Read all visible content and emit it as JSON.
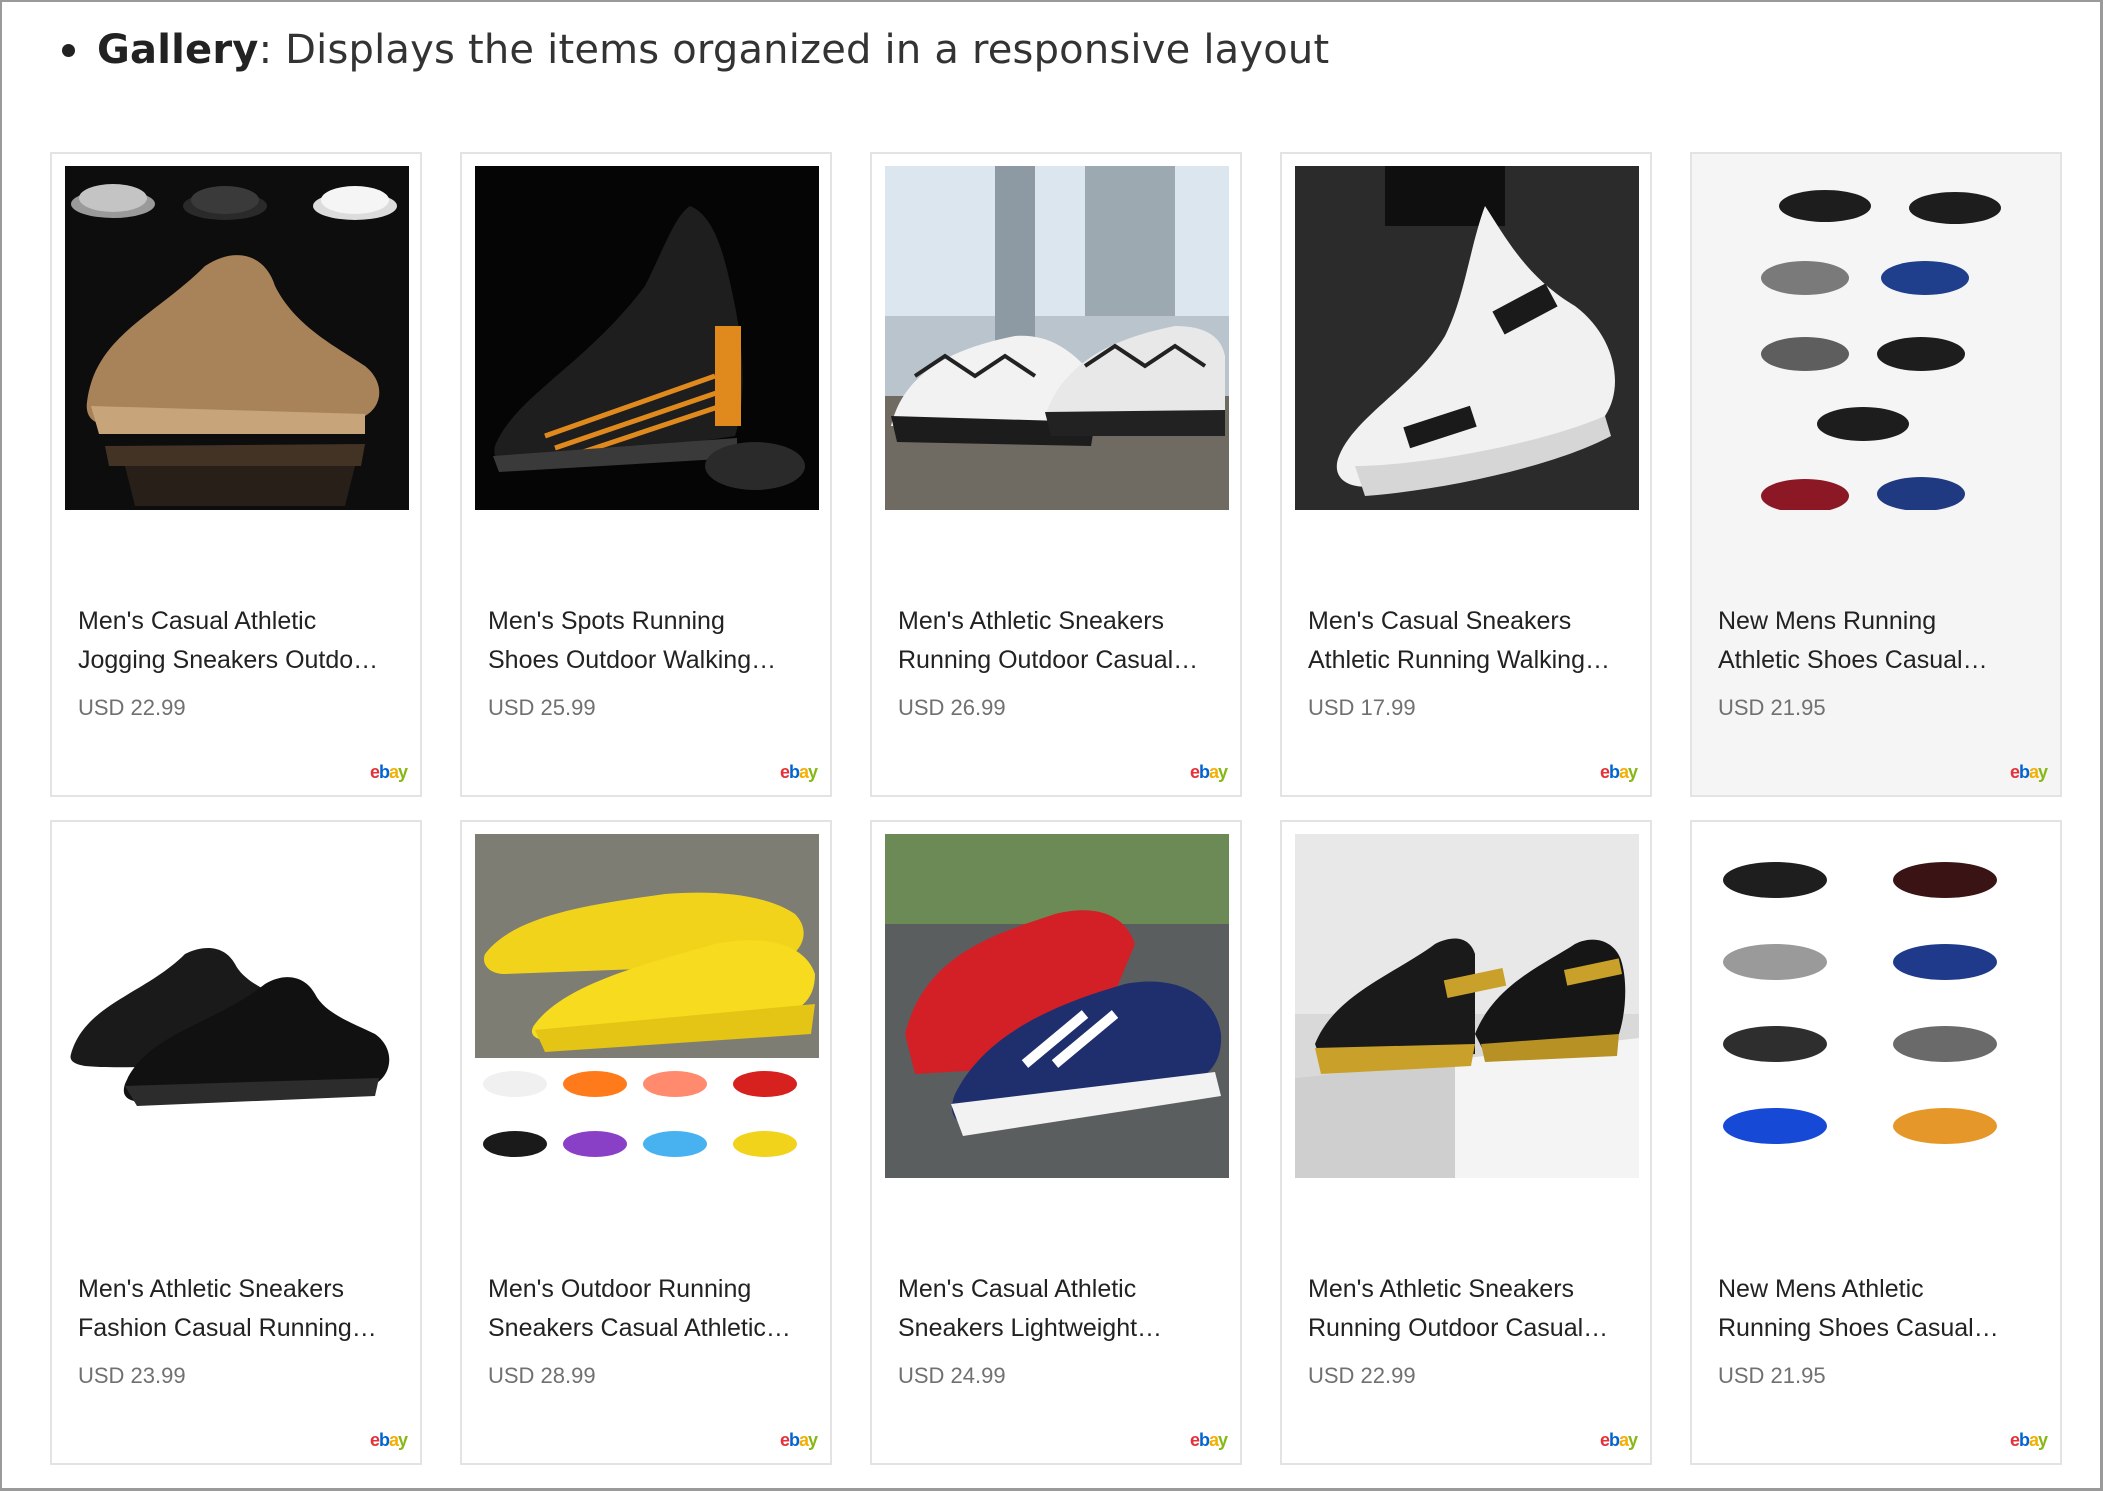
{
  "intro": {
    "label": "Gallery",
    "text": ": Displays the items organized in a responsive layout"
  },
  "gallery": {
    "items": [
      {
        "title_line1": "Men's Casual Athletic",
        "title_line2": "Jogging Sneakers Outdo…",
        "price": "USD 22.99",
        "source": "ebay",
        "image_icon": "tan-knit-sneaker-with-color-variants-photo"
      },
      {
        "title_line1": "Men's Spots Running",
        "title_line2": "Shoes Outdoor Walking…",
        "price": "USD 25.99",
        "source": "ebay",
        "image_icon": "black-orange-sneaker-photo"
      },
      {
        "title_line1": "Men's Athletic Sneakers",
        "title_line2": "Running Outdoor Casual…",
        "price": "USD 26.99",
        "source": "ebay",
        "image_icon": "white-black-pattern-sneakers-photo"
      },
      {
        "title_line1": "Men's Casual Sneakers",
        "title_line2": "Athletic Running Walking…",
        "price": "USD 17.99",
        "source": "ebay",
        "image_icon": "white-slip-on-sneaker-on-foot-photo"
      },
      {
        "title_line1": "New Mens Running",
        "title_line2": "Athletic Shoes Casual…",
        "price": "USD 21.95",
        "source": "ebay",
        "image_icon": "sneaker-color-variants-grid-photo"
      },
      {
        "title_line1": "Men's Athletic Sneakers",
        "title_line2": "Fashion Casual Running…",
        "price": "USD 23.99",
        "source": "ebay",
        "image_icon": "black-knit-sneakers-photo"
      },
      {
        "title_line1": "Men's Outdoor Running",
        "title_line2": "Sneakers Casual Athletic…",
        "price": "USD 28.99",
        "source": "ebay",
        "image_icon": "yellow-just-so-sneakers-photo"
      },
      {
        "title_line1": "Men's Casual Athletic",
        "title_line2": "Sneakers Lightweight…",
        "price": "USD 24.99",
        "source": "ebay",
        "image_icon": "red-navy-white-sneakers-photo"
      },
      {
        "title_line1": "Men's Athletic Sneakers",
        "title_line2": "Running Outdoor Casual…",
        "price": "USD 22.99",
        "source": "ebay",
        "image_icon": "black-gold-warning-sneakers-photo"
      },
      {
        "title_line1": "New Mens Athletic",
        "title_line2": "Running Shoes Casual…",
        "price": "USD 21.95",
        "source": "ebay",
        "image_icon": "sneaker-eight-colors-grid-photo"
      }
    ]
  },
  "colors": {
    "ebay_e": "#e53238",
    "ebay_b": "#0064d2",
    "ebay_a": "#f5af02",
    "ebay_y": "#86b817",
    "card_border": "#e3e3e3",
    "card_hover_bg": "#f5f5f5",
    "price_text": "#707070"
  }
}
